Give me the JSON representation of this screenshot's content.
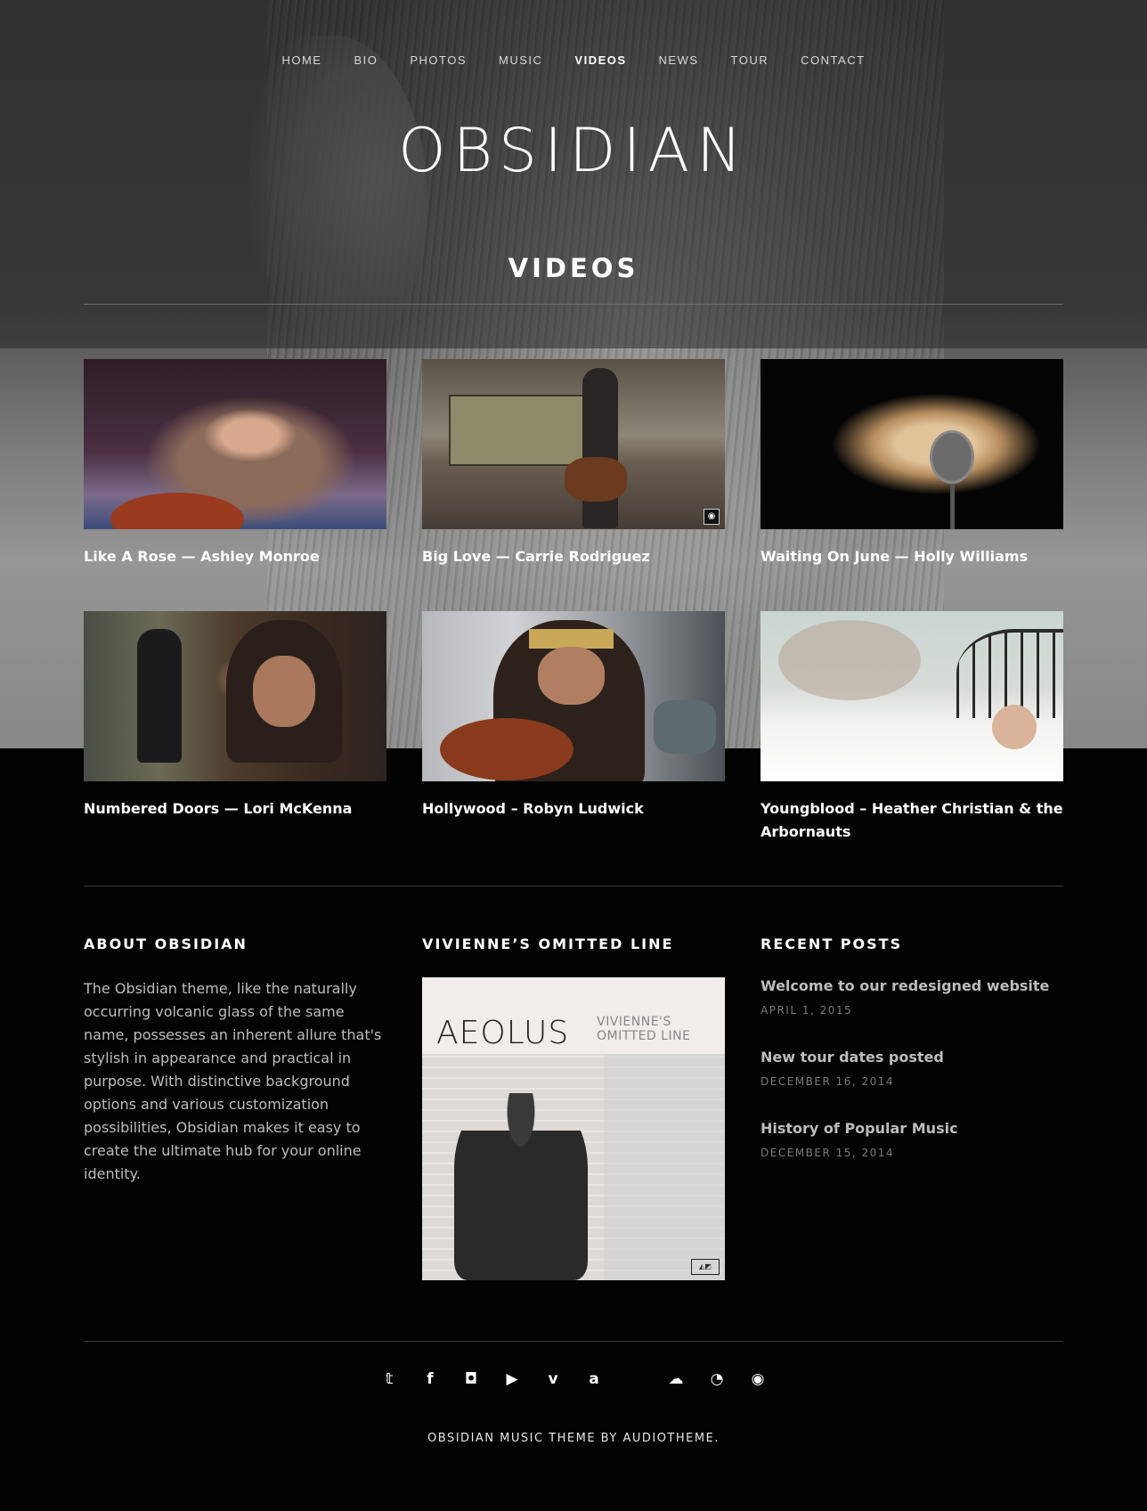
{
  "nav": {
    "items": [
      "HOME",
      "BIO",
      "PHOTOS",
      "MUSIC",
      "VIDEOS",
      "NEWS",
      "TOUR",
      "CONTACT"
    ],
    "active": "VIDEOS"
  },
  "site": {
    "title": "OBSIDIAN"
  },
  "page": {
    "title": "VIDEOS"
  },
  "videos": [
    {
      "title": "Like A Rose — Ashley Monroe"
    },
    {
      "title": "Big Love — Carrie Rodriguez"
    },
    {
      "title": "Waiting On June — Holly Williams"
    },
    {
      "title": "Numbered Doors — Lori McKenna"
    },
    {
      "title": "Hollywood – Robyn Ludwick"
    },
    {
      "title": "Youngblood – Heather Christian & the Arbornauts"
    }
  ],
  "widgets": {
    "about": {
      "title": "ABOUT OBSIDIAN",
      "text": "The Obsidian theme, like the naturally occurring volcanic glass of the same name, possesses an inherent allure that's stylish in appearance and practical in purpose. With distinctive background options and various customization possibilities, Obsidian makes it easy to create the ultimate hub for your online identity."
    },
    "album": {
      "title": "VIVIENNE’S OMITTED LINE",
      "cover_title": "AEOLUS",
      "cover_subtitle": "VIVIENNE'S OMITTED LINE"
    },
    "recent": {
      "title": "RECENT POSTS",
      "posts": [
        {
          "title": "Welcome to our redesigned website",
          "date": "APRIL 1, 2015"
        },
        {
          "title": "New tour dates posted",
          "date": "DECEMBER 16, 2014"
        },
        {
          "title": "History of Popular Music",
          "date": "DECEMBER 15, 2014"
        }
      ]
    }
  },
  "footer": {
    "social_icons": [
      "twitter-icon",
      "facebook-icon",
      "instagram-icon",
      "youtube-icon",
      "vimeo-icon",
      "amazon-icon",
      "apple-icon",
      "soundcloud-icon",
      "bandcamp-icon",
      "spotify-icon"
    ],
    "credit": "OBSIDIAN MUSIC THEME BY AUDIOTHEME."
  }
}
